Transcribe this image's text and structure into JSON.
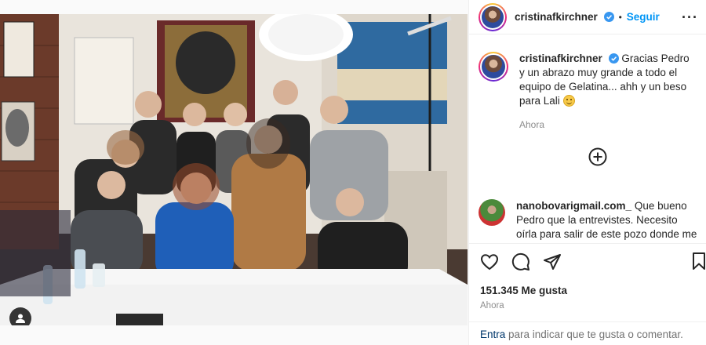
{
  "post": {
    "photo_alt": "",
    "user_tag_icon": "user-silhouette-icon"
  },
  "header": {
    "username": "cristinafkirchner",
    "separator": "•",
    "follow_label": "Seguir",
    "more_label": "···"
  },
  "caption": {
    "username": "cristinafkirchner",
    "text": "Gracias Pedro y un abrazo muy grande a todo el equipo de Gelatina... ahh y un beso para Lali",
    "time": "Ahora"
  },
  "comments": [
    {
      "username": "nanobovarigmail.com_",
      "text": "Que bueno Pedro que la entrevistes. Necesito oírla para salir de este pozo donde me metió este gobierno"
    }
  ],
  "actions": {
    "likes": "151.345 Me gusta",
    "time": "Ahora"
  },
  "footer": {
    "login_link": "Entra",
    "rest": " para indicar que te gusta o comentar."
  },
  "colors": {
    "accent": "#0095f6",
    "verified": "#3897f0",
    "muted": "#8e8e8e"
  }
}
